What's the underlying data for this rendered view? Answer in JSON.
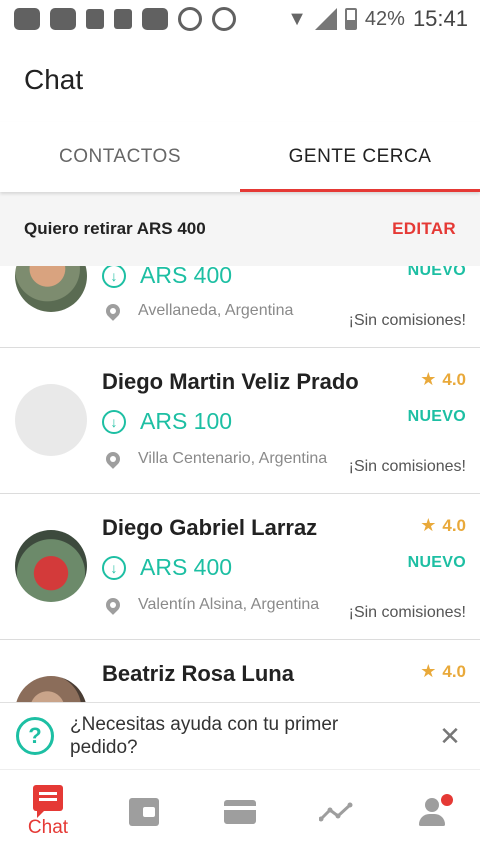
{
  "status_bar": {
    "battery": "42%",
    "time": "15:41"
  },
  "header": {
    "title": "Chat"
  },
  "tabs": [
    {
      "label": "CONTACTOS",
      "active": false
    },
    {
      "label": "GENTE CERCA",
      "active": true
    }
  ],
  "filter": {
    "text": "Quiero retirar ARS 400",
    "edit_label": "EDITAR"
  },
  "contacts": [
    {
      "name": "",
      "rating": "",
      "amount": "ARS 400",
      "badge": "NUEVO",
      "location": "Avellaneda, Argentina",
      "note": "¡Sin comisiones!"
    },
    {
      "name": "Diego Martin Veliz Prado",
      "rating": "4.0",
      "amount": "ARS 100",
      "badge": "NUEVO",
      "location": "Villa Centenario, Argentina",
      "note": "¡Sin comisiones!"
    },
    {
      "name": "Diego Gabriel Larraz",
      "rating": "4.0",
      "amount": "ARS 400",
      "badge": "NUEVO",
      "location": "Valentín Alsina, Argentina",
      "note": "¡Sin comisiones!"
    },
    {
      "name": "Beatriz Rosa Luna",
      "rating": "4.0",
      "amount": "",
      "badge": "",
      "location": "",
      "note": ""
    }
  ],
  "help_banner": {
    "text": "¿Necesitas ayuda con tu primer pedido?"
  },
  "bottom_nav": {
    "chat_label": "Chat",
    "items": [
      "chat-icon",
      "wallet-icon",
      "card-icon",
      "trend-icon",
      "profile-icon"
    ]
  },
  "colors": {
    "accent": "#e53935",
    "teal": "#1dbfa3",
    "rating": "#e9a93a"
  }
}
